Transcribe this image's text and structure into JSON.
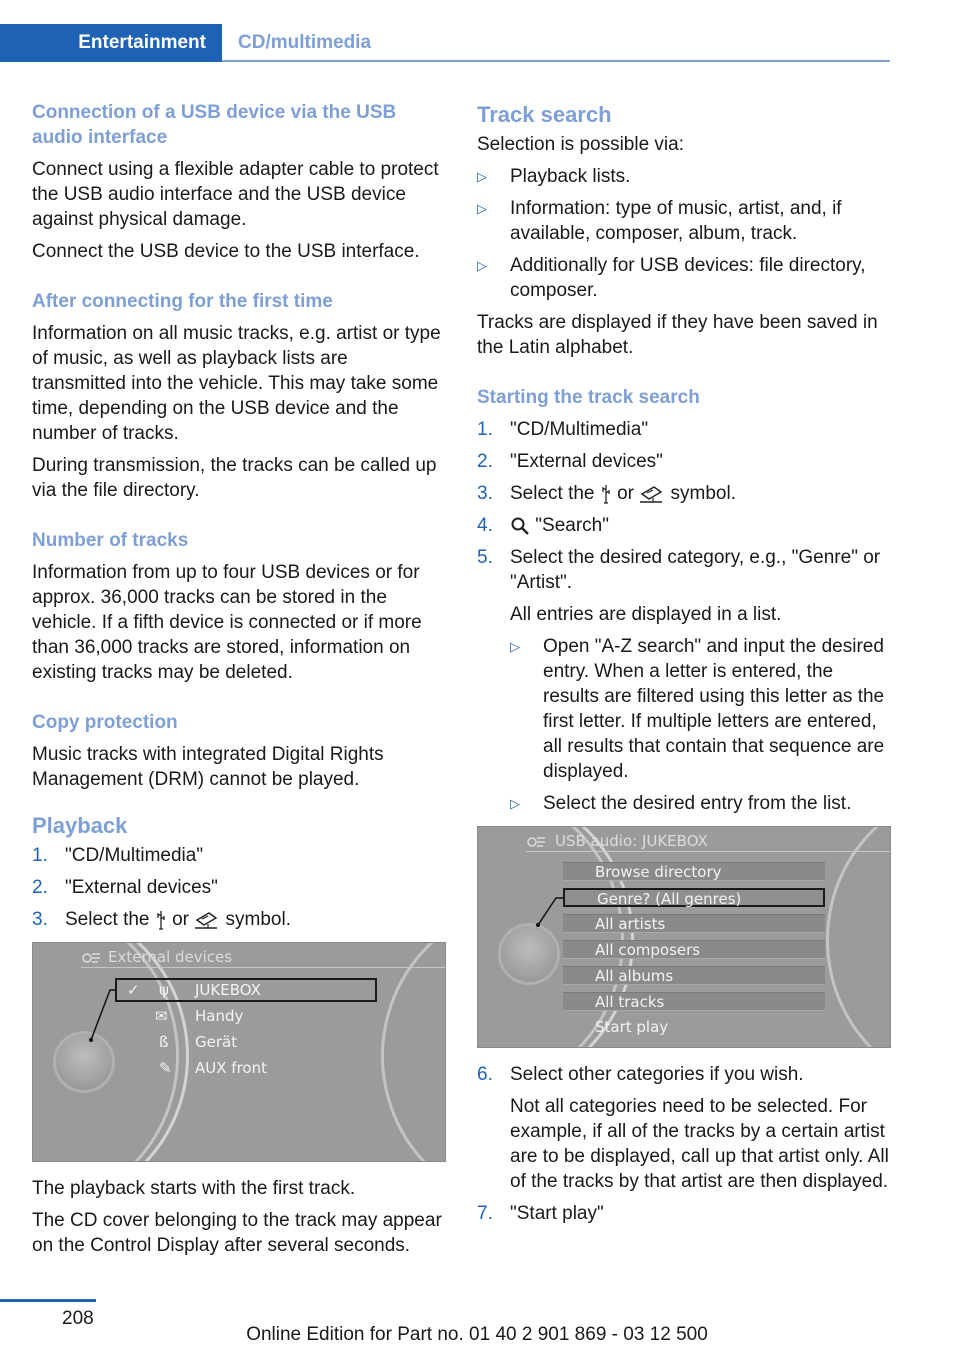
{
  "header": {
    "section": "Entertainment",
    "subsection": "CD/multimedia"
  },
  "left": {
    "usb_heading": "Connection of a USB device via the USB audio interface",
    "usb_p1": "Connect using a flexible adapter cable to protect the USB audio interface and the USB device against physical damage.",
    "usb_p2": "Connect the USB device to the USB interface.",
    "first_heading": "After connecting for the first time",
    "first_p1": "Information on all music tracks, e.g. artist or type of music, as well as playback lists are transmitted into the vehicle. This may take some time, depending on the USB device and the number of tracks.",
    "first_p2": "During transmission, the tracks can be called up via the file directory.",
    "num_heading": "Number of tracks",
    "num_p1": "Information from up to four USB devices or for approx. 36,000 tracks can be stored in the vehicle. If a fifth device is connected or if more than 36,000 tracks are stored, information on existing tracks may be deleted.",
    "copy_heading": "Copy protection",
    "copy_p1": "Music tracks with integrated Digital Rights Management (DRM) cannot be played.",
    "playback_heading": "Playback",
    "playback_steps": [
      {
        "num": "1.",
        "text": "\"CD/Multimedia\""
      },
      {
        "num": "2.",
        "text": "\"External devices\""
      },
      {
        "num": "3.",
        "pre": "Select the",
        "mid": "or",
        "post": "symbol."
      }
    ],
    "screen": {
      "title": "External devices",
      "items": [
        {
          "label": "JUKEBOX",
          "icon": "usb-icon",
          "selected": true
        },
        {
          "label": "Handy",
          "icon": "phone-icon",
          "selected": false
        },
        {
          "label": "Gerät",
          "icon": "bluetooth-icon",
          "selected": false
        },
        {
          "label": "AUX front",
          "icon": "aux-plug-icon",
          "selected": false
        }
      ]
    },
    "after_p1": "The playback starts with the first track.",
    "after_p2": "The CD cover belonging to the track may appear on the Control Display after several seconds."
  },
  "right": {
    "track_heading": "Track search",
    "track_intro": "Selection is possible via:",
    "track_bullets": [
      "Playback lists.",
      "Information: type of music, artist, and, if available, composer, album, track.",
      "Additionally for USB devices: file directory, composer."
    ],
    "track_p": "Tracks are displayed if they have been saved in the Latin alphabet.",
    "start_heading": "Starting the track search",
    "steps": [
      {
        "num": "1.",
        "text": "\"CD/Multimedia\""
      },
      {
        "num": "2.",
        "text": "\"External devices\""
      },
      {
        "num": "3.",
        "pre": "Select the",
        "mid": "or",
        "post": "symbol."
      },
      {
        "num": "4.",
        "text": "\"Search\""
      },
      {
        "num": "5.",
        "text": "Select the desired category, e.g., \"Genre\" or \"Artist\"."
      }
    ],
    "step5_note": "All entries are displayed in a list.",
    "step5_bullets": [
      "Open \"A-Z search\" and input the desired entry. When a letter is entered, the results are filtered using this letter as the first letter. If multiple letters are entered, all results that contain that sequence are displayed.",
      "Select the desired entry from the list."
    ],
    "screen": {
      "title": "USB audio: JUKEBOX",
      "items": [
        {
          "label": "Browse directory",
          "selected": false
        },
        {
          "label": "Genre? (All genres)",
          "selected": true
        },
        {
          "label": "All artists",
          "selected": false
        },
        {
          "label": "All composers",
          "selected": false
        },
        {
          "label": "All albums",
          "selected": false
        },
        {
          "label": "All tracks",
          "selected": false
        },
        {
          "label": "Start play",
          "selected": false
        }
      ]
    },
    "step6": {
      "num": "6.",
      "text": "Select other categories if you wish."
    },
    "step6_note": "Not all categories need to be selected. For example, if all of the tracks by a certain artist are to be displayed, call up that artist only. All of the tracks by that artist are then displayed.",
    "step7": {
      "num": "7.",
      "text": "\"Start play\""
    }
  },
  "footer": {
    "page": "208",
    "edition": "Online Edition for Part no. 01 40 2 901 869 - 03 12 500"
  },
  "colors": {
    "accent": "#1e62b5",
    "heading": "#7e9fd6"
  }
}
